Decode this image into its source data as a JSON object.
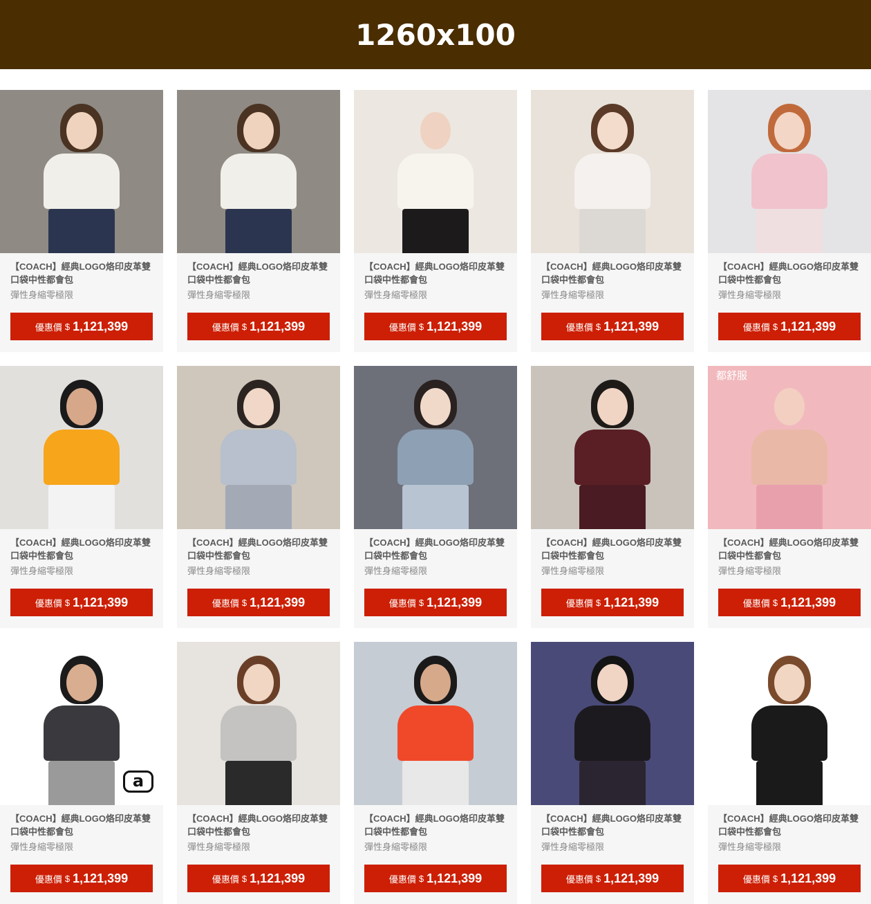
{
  "banner": {
    "text": "1260x100",
    "color": "#4a2d00"
  },
  "accent": {
    "price_button": "#cc1f05",
    "card_bg": "#f6f6f6"
  },
  "products": [
    {
      "title": "【COACH】經典LOGO烙印皮革雙口袋中性都會包",
      "subtitle": "彈性身縮零極限",
      "price_label": "優惠價",
      "currency": "$",
      "price": "1,121,399",
      "image": {
        "bg": "#8f8a84",
        "hair": "#4a3322",
        "top": "#f1efe9",
        "bottom": "#2b3550",
        "skin": "#f0d3be"
      }
    },
    {
      "title": "【COACH】經典LOGO烙印皮革雙口袋中性都會包",
      "subtitle": "彈性身縮零極限",
      "price_label": "優惠價",
      "currency": "$",
      "price": "1,121,399",
      "image": {
        "bg": "#8f8a84",
        "hair": "#4a3322",
        "top": "#f1efe9",
        "bottom": "#2b3550",
        "skin": "#f0d3be"
      }
    },
    {
      "title": "【COACH】經典LOGO烙印皮革雙口袋中性都會包",
      "subtitle": "彈性身縮零極限",
      "price_label": "優惠價",
      "currency": "$",
      "price": "1,121,399",
      "image": {
        "bg": "#ece7e1",
        "hair": "#ece7e1",
        "top": "#f7f4ee",
        "bottom": "#1c1a1a",
        "skin": "#efd2c1"
      }
    },
    {
      "title": "【COACH】經典LOGO烙印皮革雙口袋中性都會包",
      "subtitle": "彈性身縮零極限",
      "price_label": "優惠價",
      "currency": "$",
      "price": "1,121,399",
      "image": {
        "bg": "#e9e2da",
        "hair": "#5b3a28",
        "top": "#f4f1ee",
        "bottom": "#dcd8d4",
        "skin": "#f4dccd"
      }
    },
    {
      "title": "【COACH】經典LOGO烙印皮革雙口袋中性都會包",
      "subtitle": "彈性身縮零極限",
      "price_label": "優惠價",
      "currency": "$",
      "price": "1,121,399",
      "image": {
        "bg": "#e4e4e6",
        "hair": "#c06a3c",
        "top": "#f1c4cd",
        "bottom": "#efdfe0",
        "skin": "#f4d6c6"
      }
    },
    {
      "title": "【COACH】經典LOGO烙印皮革雙口袋中性都會包",
      "subtitle": "彈性身縮零極限",
      "price_label": "優惠價",
      "currency": "$",
      "price": "1,121,399",
      "image": {
        "bg": "#e2e0dd",
        "hair": "#1a1a1a",
        "top": "#f7a51b",
        "bottom": "#f3f3f3",
        "skin": "#d6a789"
      }
    },
    {
      "title": "【COACH】經典LOGO烙印皮革雙口袋中性都會包",
      "subtitle": "彈性身縮零極限",
      "price_label": "優惠價",
      "currency": "$",
      "price": "1,121,399",
      "image": {
        "bg": "#cfc7bb",
        "hair": "#2c2420",
        "top": "#b7c0cc",
        "bottom": "#a3aab6",
        "skin": "#f0d7c7"
      }
    },
    {
      "title": "【COACH】經典LOGO烙印皮革雙口袋中性都會包",
      "subtitle": "彈性身縮零極限",
      "price_label": "優惠價",
      "currency": "$",
      "price": "1,121,399",
      "image": {
        "bg": "#6d7079",
        "hair": "#2a2220",
        "top": "#8ea0b4",
        "bottom": "#b8c4d2",
        "skin": "#f1d9ca"
      }
    },
    {
      "title": "【COACH】經典LOGO烙印皮革雙口袋中性都會包",
      "subtitle": "彈性身縮零極限",
      "price_label": "優惠價",
      "currency": "$",
      "price": "1,121,399",
      "image": {
        "bg": "#c9c3bc",
        "hair": "#1e1a18",
        "top": "#5a1f25",
        "bottom": "#4a1b22",
        "skin": "#f0d5c4"
      }
    },
    {
      "title": "【COACH】經典LOGO烙印皮革雙口袋中性都會包",
      "subtitle": "彈性身縮零極限",
      "price_label": "優惠價",
      "currency": "$",
      "price": "1,121,399",
      "overlay": "都舒服",
      "image": {
        "bg": "#f1b9bd",
        "hair": "#f1b9bd",
        "top": "#e9b8a7",
        "bottom": "#e9a0ad",
        "skin": "#f3cfc1"
      }
    },
    {
      "title": "【COACH】經典LOGO烙印皮革雙口袋中性都會包",
      "subtitle": "彈性身縮零極限",
      "price_label": "優惠價",
      "currency": "$",
      "price": "1,121,399",
      "badge": "a",
      "image": {
        "bg": "#ffffff",
        "hair": "#1b1b1b",
        "top": "#3a3a3e",
        "bottom": "#9a9a9a",
        "skin": "#d9ad8f"
      }
    },
    {
      "title": "【COACH】經典LOGO烙印皮革雙口袋中性都會包",
      "subtitle": "彈性身縮零極限",
      "price_label": "優惠價",
      "currency": "$",
      "price": "1,121,399",
      "image": {
        "bg": "#e7e3de",
        "hair": "#6a3f28",
        "top": "#c4c3c1",
        "bottom": "#2a2a2a",
        "skin": "#f1d6c4"
      }
    },
    {
      "title": "【COACH】經典LOGO烙印皮革雙口袋中性都會包",
      "subtitle": "彈性身縮零極限",
      "price_label": "優惠價",
      "currency": "$",
      "price": "1,121,399",
      "image": {
        "bg": "#c6ccd4",
        "hair": "#1a1a1a",
        "top": "#f0492a",
        "bottom": "#e8e8e8",
        "skin": "#d6a98b"
      }
    },
    {
      "title": "【COACH】經典LOGO烙印皮革雙口袋中性都會包",
      "subtitle": "彈性身縮零極限",
      "price_label": "優惠價",
      "currency": "$",
      "price": "1,121,399",
      "image": {
        "bg": "#4a4a78",
        "hair": "#141414",
        "top": "#1c1a1f",
        "bottom": "#2a2530",
        "skin": "#f0d4c4"
      }
    },
    {
      "title": "【COACH】經典LOGO烙印皮革雙口袋中性都會包",
      "subtitle": "彈性身縮零極限",
      "price_label": "優惠價",
      "currency": "$",
      "price": "1,121,399",
      "image": {
        "bg": "#ffffff",
        "hair": "#7a4a2c",
        "top": "#1a1a1a",
        "bottom": "#1a1a1a",
        "skin": "#f2d6c4"
      }
    }
  ]
}
